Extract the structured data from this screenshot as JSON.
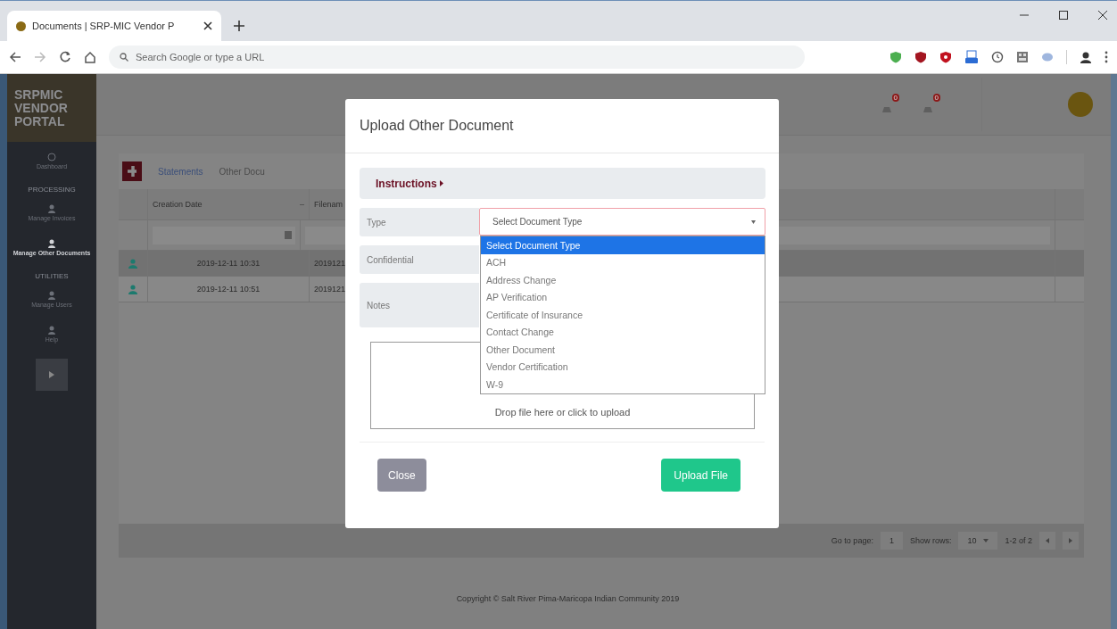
{
  "browser": {
    "tab_title": "Documents | SRP-MIC Vendor P",
    "address_placeholder": "Search Google or type a URL"
  },
  "sidebar": {
    "logo": [
      "SRPMIC",
      "VENDOR",
      "PORTAL"
    ],
    "nav": [
      {
        "label": "Dashboard",
        "selected": false
      }
    ],
    "sections": [
      {
        "heading": "PROCESSING",
        "items": [
          {
            "label": "Manage Invoices",
            "selected": false
          },
          {
            "label": "Manage Other Documents",
            "selected": true
          }
        ]
      },
      {
        "heading": "UTILITIES",
        "items": [
          {
            "label": "Manage Users",
            "selected": false
          },
          {
            "label": "Help",
            "selected": false
          }
        ]
      }
    ]
  },
  "header": {
    "notifications": [
      {
        "count": "0"
      },
      {
        "count": "0"
      }
    ]
  },
  "tabs": [
    {
      "label": "Statements",
      "selected": true
    },
    {
      "label": "Other Docu",
      "selected": false
    }
  ],
  "table": {
    "columns": [
      {
        "label": "Creation Date",
        "sort": "–"
      },
      {
        "label": "Filenam"
      }
    ],
    "rows": [
      {
        "creation_date": "2019-12-11 10:31",
        "filename": "2019121",
        "selected": true
      },
      {
        "creation_date": "2019-12-11 10:51",
        "filename": "2019121",
        "selected": false
      }
    ]
  },
  "pager": {
    "go_to_label": "Go to page:",
    "page": "1",
    "rows_label": "Show rows:",
    "rows_per_page": "10",
    "range": "1-2 of 2"
  },
  "footer": "Copyright © Salt River Pima-Maricopa Indian Community 2019",
  "modal": {
    "title": "Upload Other Document",
    "instructions": "Instructions",
    "fields": [
      {
        "label": "Type"
      },
      {
        "label": "Confidential"
      },
      {
        "label": "Notes"
      }
    ],
    "type_select": {
      "value": "Select Document Type",
      "options": [
        {
          "label": "Select Document Type",
          "selected": true
        },
        {
          "label": "ACH",
          "selected": false
        },
        {
          "label": "Address Change",
          "selected": false
        },
        {
          "label": "AP Verification",
          "selected": false
        },
        {
          "label": "Certificate of Insurance",
          "selected": false
        },
        {
          "label": "Contact Change",
          "selected": false
        },
        {
          "label": "Other Document",
          "selected": false
        },
        {
          "label": "Vendor Certification",
          "selected": false
        },
        {
          "label": "W-9",
          "selected": false
        }
      ]
    },
    "dropzone": "Drop file here or click to upload",
    "buttons": [
      {
        "kind": "secondary",
        "label": "Close"
      },
      {
        "kind": "primary",
        "label": "Upload File"
      }
    ]
  }
}
